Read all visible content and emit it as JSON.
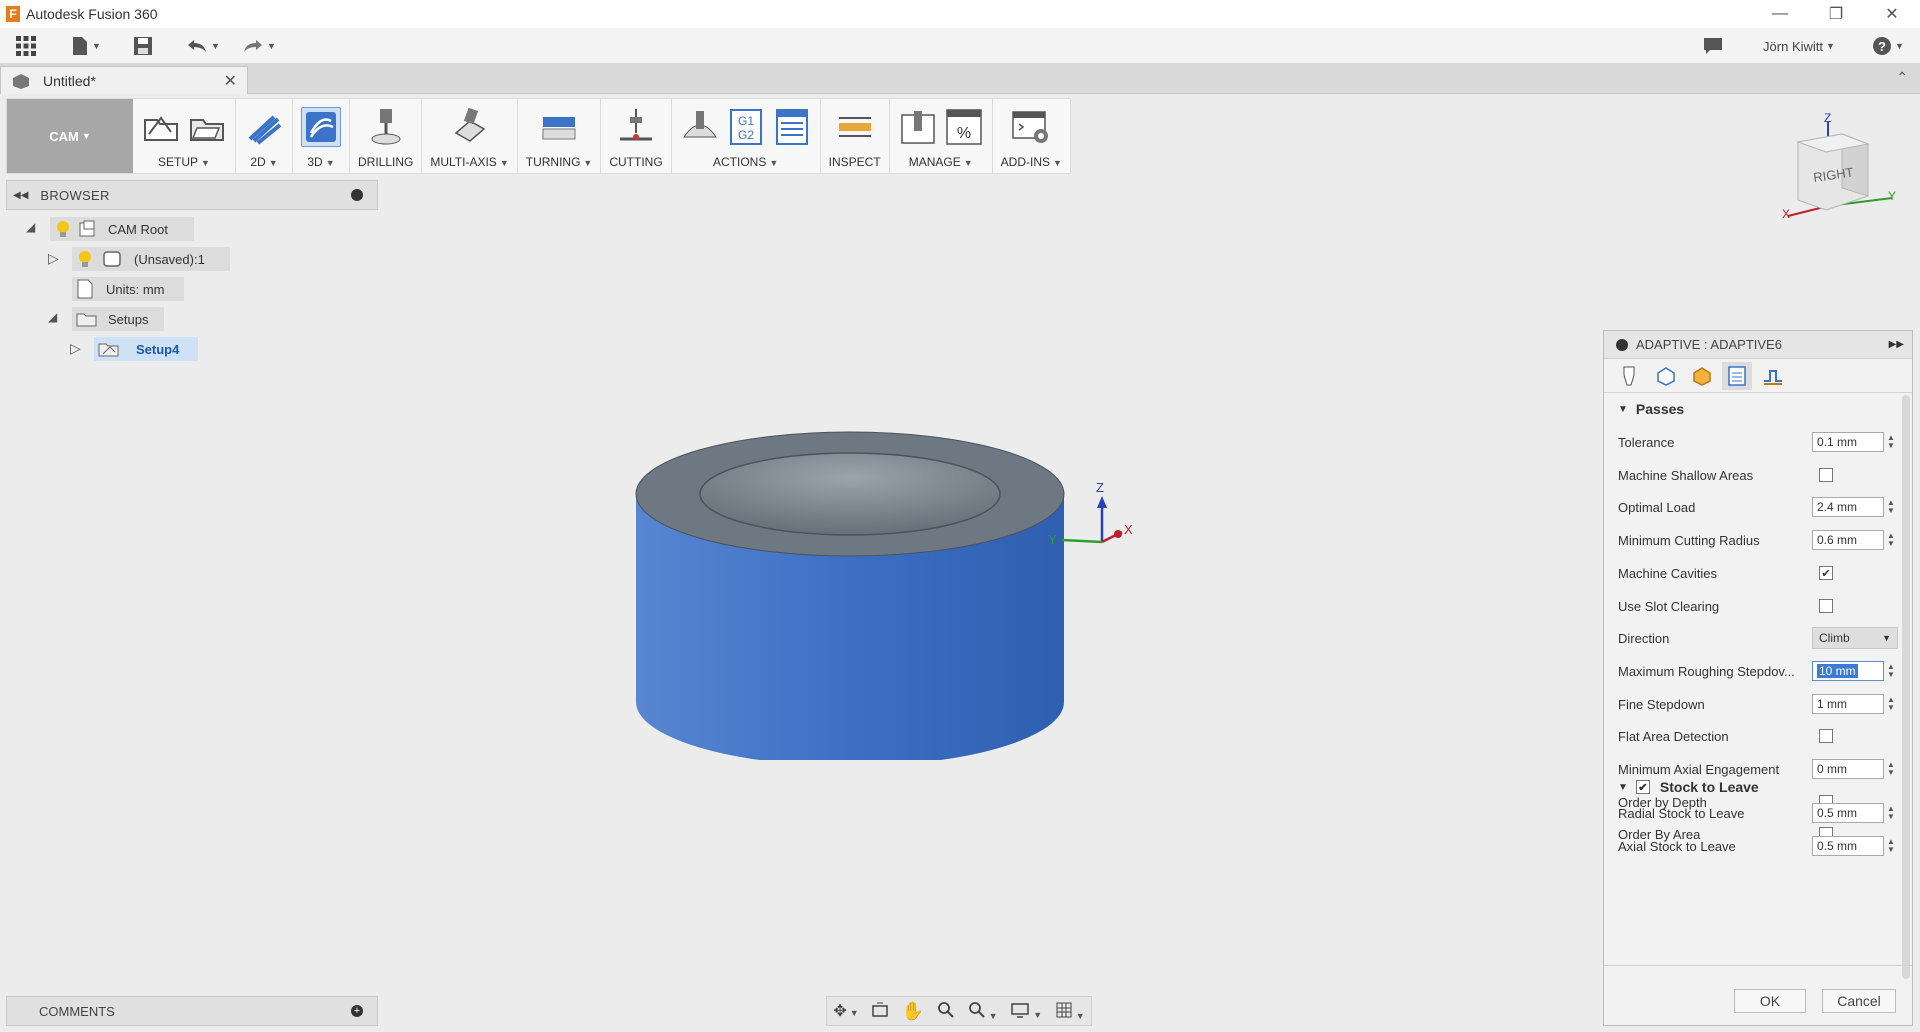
{
  "window": {
    "title": "Autodesk Fusion 360",
    "logo_letter": "F"
  },
  "quick_access": {
    "user_name": "Jörn Kiwitt"
  },
  "tab": {
    "title": "Untitled*"
  },
  "toolbar": {
    "workspace": "CAM",
    "groups": [
      {
        "label": "SETUP",
        "dropdown": true
      },
      {
        "label": "2D",
        "dropdown": true
      },
      {
        "label": "3D",
        "dropdown": true
      },
      {
        "label": "DRILLING",
        "dropdown": false
      },
      {
        "label": "MULTI-AXIS",
        "dropdown": true
      },
      {
        "label": "TURNING",
        "dropdown": true
      },
      {
        "label": "CUTTING",
        "dropdown": false
      },
      {
        "label": "ACTIONS",
        "dropdown": true
      },
      {
        "label": "INSPECT",
        "dropdown": false
      },
      {
        "label": "MANAGE",
        "dropdown": true
      },
      {
        "label": "ADD-INS",
        "dropdown": true
      }
    ],
    "actions_icon_text": [
      "G1",
      "G2"
    ],
    "manage_icon_text": "%"
  },
  "browser": {
    "title": "BROWSER",
    "nodes": [
      {
        "label": "CAM Root"
      },
      {
        "label": "(Unsaved):1"
      },
      {
        "label": "Units: mm"
      },
      {
        "label": "Setups"
      },
      {
        "label": "Setup4"
      }
    ]
  },
  "comments": {
    "title": "COMMENTS"
  },
  "viewcube": {
    "face": "RIGHT",
    "axes": {
      "z": "Z",
      "x": "X",
      "y": "Y"
    }
  },
  "triad": {
    "z": "Z",
    "y": "Y",
    "x": "X"
  },
  "dialog": {
    "title": "ADAPTIVE : ADAPTIVE6",
    "section_passes": "Passes",
    "rows": [
      {
        "label": "Tolerance",
        "type": "number",
        "value": "0.1 mm"
      },
      {
        "label": "Machine Shallow Areas",
        "type": "check",
        "checked": false
      },
      {
        "label": "Optimal Load",
        "type": "number",
        "value": "2.4 mm"
      },
      {
        "label": "Minimum Cutting Radius",
        "type": "number",
        "value": "0.6 mm"
      },
      {
        "label": "Machine Cavities",
        "type": "check",
        "checked": true
      },
      {
        "label": "Use Slot Clearing",
        "type": "check",
        "checked": false
      },
      {
        "label": "Direction",
        "type": "select",
        "value": "Climb"
      },
      {
        "label": "Maximum Roughing Stepdov...",
        "type": "number",
        "value": "10 mm",
        "active": true
      },
      {
        "label": "Fine Stepdown",
        "type": "number",
        "value": "1 mm"
      },
      {
        "label": "Flat Area Detection",
        "type": "check",
        "checked": false
      },
      {
        "label": "Minimum Axial Engagement",
        "type": "number",
        "value": "0 mm"
      },
      {
        "label": "Order by Depth",
        "type": "check",
        "checked": false
      },
      {
        "label": "Order By Area",
        "type": "check",
        "checked": false
      }
    ],
    "section_stock": "Stock to Leave",
    "stock_rows": [
      {
        "label": "Radial Stock to Leave",
        "value": "0.5 mm"
      },
      {
        "label": "Axial Stock to Leave",
        "value": "0.5 mm"
      }
    ],
    "ok": "OK",
    "cancel": "Cancel"
  },
  "colors": {
    "accent": "#3a7bd5",
    "model_blue": "#3f73c8",
    "model_top": "#6e7883"
  }
}
